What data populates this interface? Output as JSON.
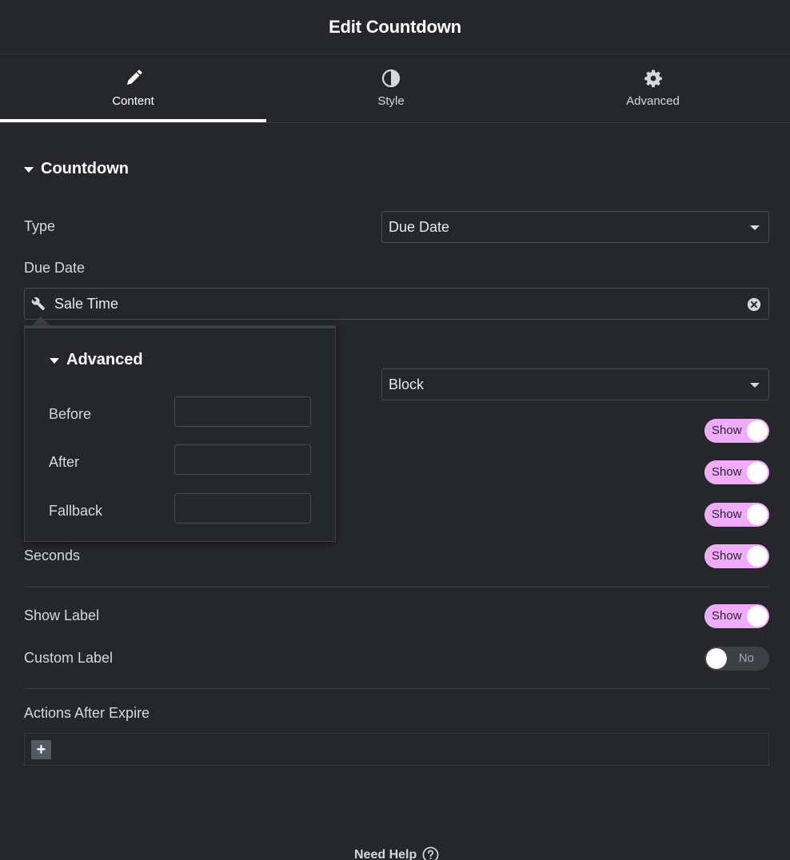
{
  "header": {
    "title": "Edit Countdown"
  },
  "tabs": [
    {
      "label": "Content",
      "icon": "pencil-icon",
      "active": true
    },
    {
      "label": "Style",
      "icon": "contrast-icon",
      "active": false
    },
    {
      "label": "Advanced",
      "icon": "gear-icon",
      "active": false
    }
  ],
  "section": {
    "title": "Countdown"
  },
  "fields": {
    "type": {
      "label": "Type",
      "value": "Due Date"
    },
    "due_date": {
      "label": "Due Date",
      "value": "Sale Time",
      "icon": "wrench-icon"
    },
    "view": {
      "value": "Block"
    }
  },
  "popover": {
    "title": "Advanced",
    "before": {
      "label": "Before",
      "value": ""
    },
    "after": {
      "label": "After",
      "value": ""
    },
    "fallback": {
      "label": "Fallback",
      "value": ""
    }
  },
  "toggles": {
    "days": {
      "text": "Show",
      "state": "on"
    },
    "hours": {
      "text": "Show",
      "state": "on"
    },
    "minutes": {
      "text": "Show",
      "state": "on"
    },
    "seconds": {
      "label": "Seconds",
      "text": "Show",
      "state": "on"
    },
    "show_label": {
      "label": "Show Label",
      "text": "Show",
      "state": "on"
    },
    "custom_label": {
      "label": "Custom Label",
      "text": "No",
      "state": "off"
    }
  },
  "actions": {
    "label": "Actions After Expire",
    "add_symbol": "+"
  },
  "footer": {
    "help_text": "Need Help"
  },
  "colors": {
    "background": "#26272b",
    "toggle_on": "#f0abfc",
    "toggle_off": "#3f4045",
    "border": "#4a4b50"
  }
}
